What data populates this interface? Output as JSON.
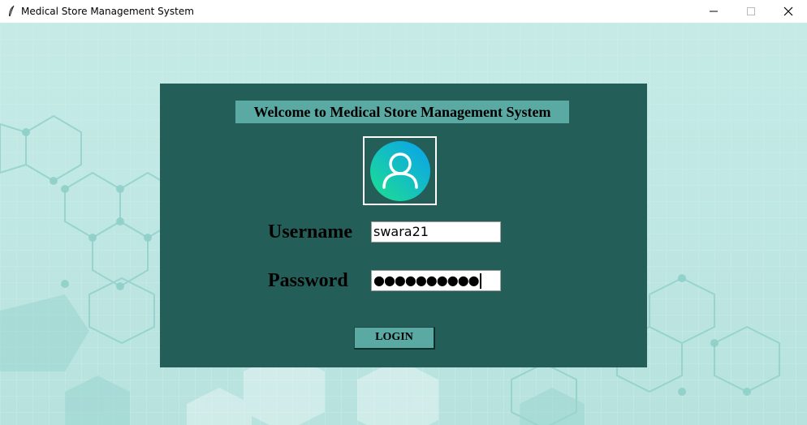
{
  "window": {
    "title": "Medical Store Management System",
    "icon": "feather-icon",
    "controls": [
      "minimize-icon",
      "maximize-icon",
      "close-icon"
    ]
  },
  "login_panel": {
    "welcome_text": "Welcome to Medical Store Management System",
    "avatar_icon": "user-avatar-icon",
    "username_label": "Username",
    "username_value": "swara21",
    "password_label": "Password",
    "password_masked": "●●●●●●●●●●",
    "login_button": "LOGIN"
  },
  "colors": {
    "panel_bg": "#245e58",
    "accent": "#5aa9a3",
    "background": "#bfe6e2"
  }
}
